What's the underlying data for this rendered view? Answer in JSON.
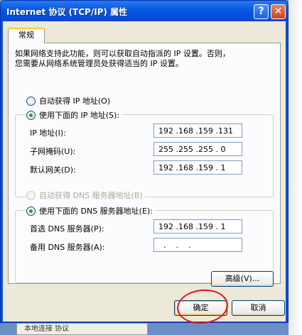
{
  "window": {
    "title": "Internet 协议 (TCP/IP) 属性",
    "help_label": "?",
    "close_label": "✕"
  },
  "tabs": [
    {
      "label": "常规",
      "selected": true
    }
  ],
  "description": "如果网络支持此功能，则可以获取自动指派的 IP 设置。否则，\n您需要从网络系统管理员处获得适当的 IP 设置。",
  "ip_section": {
    "auto_option": {
      "label": "自动获得 IP 地址(O)",
      "checked": false
    },
    "manual_option": {
      "label": "使用下面的 IP 地址(S):",
      "checked": true
    },
    "fields": [
      {
        "label": "IP 地址(I):",
        "value": "192 .168 .159 .131"
      },
      {
        "label": "子网掩码(U):",
        "value": "255 .255 .255 . 0"
      },
      {
        "label": "默认网关(D):",
        "value": "192 .168 .159 . 1"
      }
    ]
  },
  "dns_section": {
    "auto_option": {
      "label": "自动获得 DNS 服务器地址(B)",
      "checked": false,
      "disabled": true
    },
    "manual_option": {
      "label": "使用下面的 DNS 服务器地址(E):",
      "checked": true
    },
    "fields": [
      {
        "label": "首选 DNS 服务器(P):",
        "value": "192 .168 .159 . 1"
      },
      {
        "label": "备用 DNS 服务器(A):",
        "value": "  .    .    ."
      }
    ]
  },
  "buttons": {
    "advanced": "高级(V)...",
    "ok": "确定",
    "cancel": "取消"
  },
  "background_window": {
    "label": "本地连接 协议"
  },
  "colors": {
    "annotation": "#e01515",
    "titlebar": "#0450dd"
  }
}
